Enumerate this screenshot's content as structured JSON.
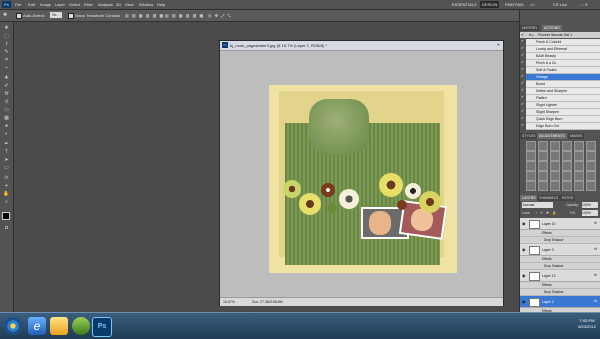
{
  "app": {
    "logo": "Ps",
    "workspace_label": "ESSENTIALS",
    "design_label": "DESIGN",
    "painting_label": "PAINTING",
    "extra_label": ">>",
    "cslive_label": "CS Live"
  },
  "menu": [
    "File",
    "Edit",
    "Image",
    "Layer",
    "Select",
    "Filter",
    "Analysis",
    "3D",
    "View",
    "Window",
    "Help"
  ],
  "options_bar": {
    "auto_select_label": "Auto-Select:",
    "auto_select_value": "Gr...",
    "show_transform_label": "Show Transform Controls"
  },
  "document": {
    "title": "bj_roots_pagestarter3.jpg @ 16.7% (Layer 2, RGB/8) *",
    "zoom": "16.67%",
    "doc_info": "Doc: 27.3M/158.8M"
  },
  "panels": {
    "history_tab": "HISTORY",
    "actions_tab": "ACTIONS",
    "styles_tab": "STYLES",
    "adjustments_tab": "ADJUSTMENTS",
    "masks_tab": "MASKS",
    "layers_tab": "LAYERS",
    "channels_tab": "CHANNELS",
    "paths_tab": "PATHS",
    "action_set": "Pioneer Woman Set 1",
    "actions": [
      {
        "label": "Fresh & Colorful",
        "selected": false
      },
      {
        "label": "Lovely and Ethereal",
        "selected": false
      },
      {
        "label": "B&W Beauty",
        "selected": false
      },
      {
        "label": "Pinch & a Zo",
        "selected": false
      },
      {
        "label": "Soft & Faded",
        "selected": false
      },
      {
        "label": "Vintage",
        "selected": true
      },
      {
        "label": "Boost",
        "selected": false
      },
      {
        "label": "Define and Sharpen",
        "selected": false
      },
      {
        "label": "Flatten",
        "selected": false
      },
      {
        "label": "Slight Lighten",
        "selected": false
      },
      {
        "label": "Slight Sharpen",
        "selected": false
      },
      {
        "label": "Quick Edge Burn",
        "selected": false
      },
      {
        "label": "Edge Burn Out",
        "selected": false
      }
    ],
    "blend_mode": "Normal",
    "opacity_label": "Opacity:",
    "opacity_value": "100%",
    "lock_label": "Lock:",
    "fill_label": "Fill:",
    "fill_value": "100%",
    "layers": [
      {
        "name": "Layer 10",
        "fx": "fx",
        "selected": false
      },
      {
        "name": "Layer 3",
        "fx": "fx",
        "selected": false
      },
      {
        "name": "Layer 12",
        "fx": "fx",
        "selected": false
      },
      {
        "name": "Layer 2",
        "fx": "fx",
        "selected": true
      }
    ],
    "effects_label": "Effects",
    "drop_shadow_label": "Drop Shadow"
  },
  "taskbar": {
    "time": "7:05 PM",
    "date": "6/23/2012"
  },
  "colors": {
    "accent": "#3a77d3",
    "panel": "#535353",
    "workspace": "#4b4b4b",
    "page_green": "#6f8c4a",
    "page_cream": "#efe2a2"
  }
}
